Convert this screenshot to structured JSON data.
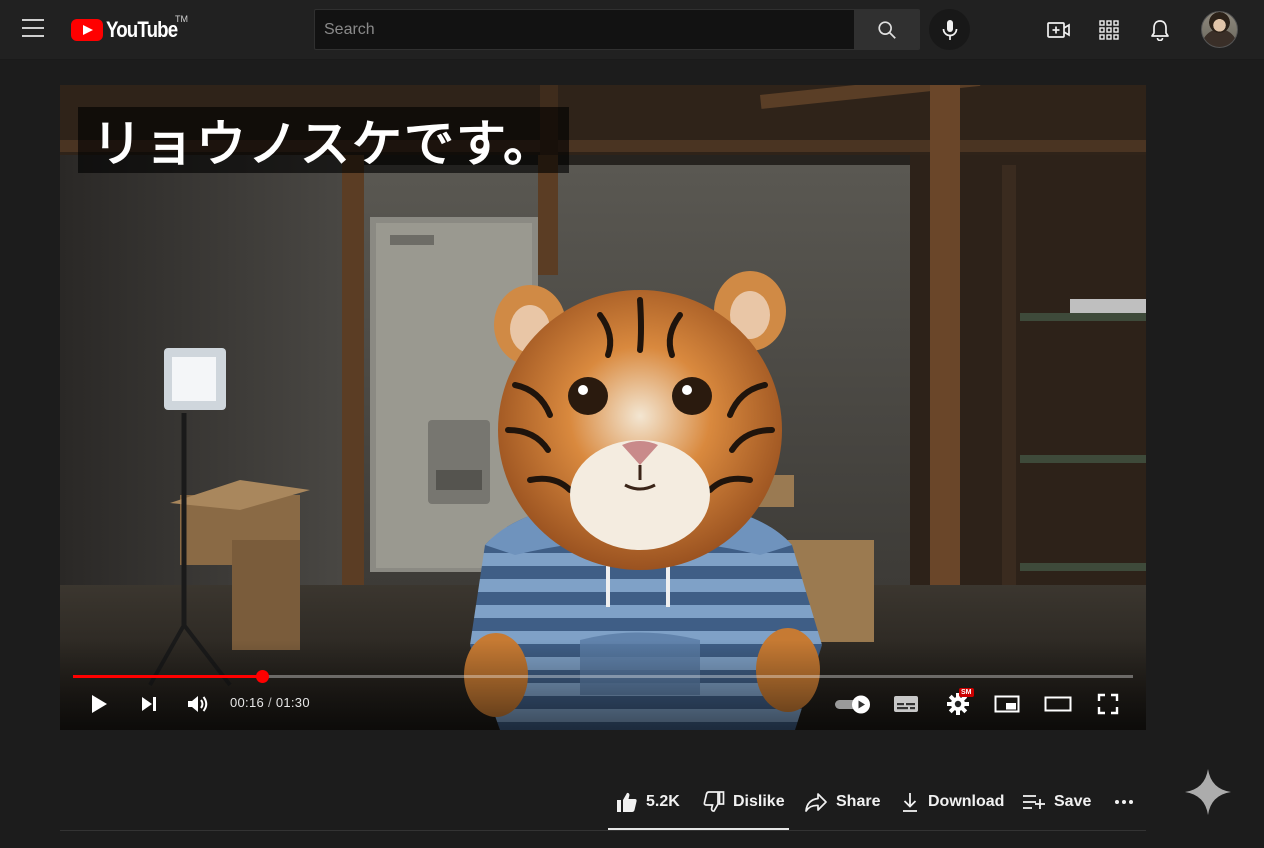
{
  "header": {
    "logo_text": "YouTube",
    "logo_tm": "TM",
    "search_placeholder": "Search"
  },
  "player": {
    "caption": "リョウノスケです。",
    "current_time": "00:16",
    "time_separator": "/",
    "duration": "01:30",
    "progress_fraction": 0.178,
    "quality_badge": "SM",
    "progress_color": "#ff0000"
  },
  "actions": {
    "like_count": "5.2K",
    "dislike_label": "Dislike",
    "share_label": "Share",
    "download_label": "Download",
    "save_label": "Save"
  },
  "icons": {
    "menu": "hamburger-menu-icon",
    "search": "search-icon",
    "mic": "microphone-icon",
    "create": "create-video-icon",
    "apps": "apps-grid-icon",
    "notifications": "bell-icon",
    "more": "more-horizontal-icon",
    "sparkle": "sparkle-icon"
  }
}
